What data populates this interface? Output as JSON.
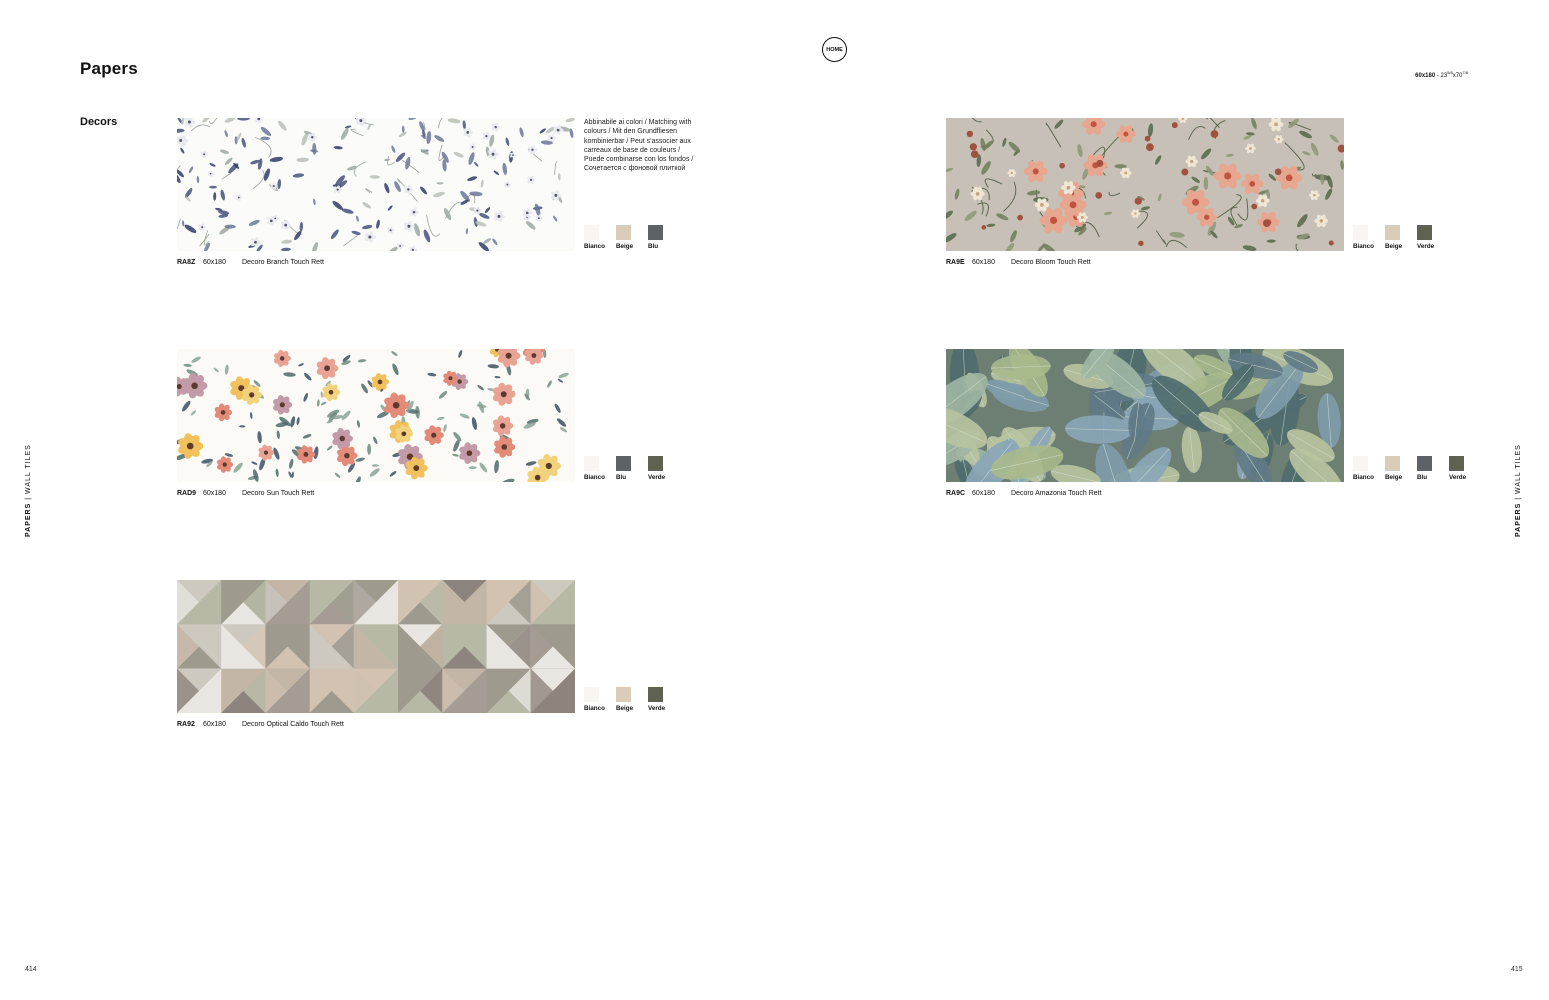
{
  "page": {
    "title": "Papers",
    "section": "Decors",
    "home_label": "HOME",
    "format_code": "60x180",
    "format_imperial": " - 23",
    "format_imperial_in1": "5/8",
    "format_imperial_x": "x70",
    "format_imperial_in2": "7/8",
    "side_label_strong": "PAPERS",
    "side_label_rest": " | WALL TILES",
    "page_left": "414",
    "page_right": "415",
    "matching_note": "Abbinabile ai colori / Matching with colours / Mit den Grundfliesen kombinierbar / Peut s'associer aux carreaux de base de couleurs / Puede combinarse con los fondos / Сочетается с фоновой плиткой"
  },
  "colors": {
    "Bianco": "#f7f6f3",
    "Beige": "#d9cdb9",
    "Blu": "#5b6368",
    "Verde": "#5f6152"
  },
  "products": [
    {
      "code": "RA8Z",
      "size": "60x180",
      "name": "Decoro Branch Touch Rett",
      "pattern": "branch",
      "swatches": [
        "Bianco",
        "Beige",
        "Blu"
      ]
    },
    {
      "code": "RA9E",
      "size": "60x180",
      "name": "Decoro Bloom Touch Rett",
      "pattern": "bloom",
      "swatches": [
        "Bianco",
        "Beige",
        "Verde"
      ]
    },
    {
      "code": "RAD9",
      "size": "60x180",
      "name": "Decoro Sun Touch Rett",
      "pattern": "sun",
      "swatches": [
        "Bianco",
        "Blu",
        "Verde"
      ]
    },
    {
      "code": "RA9C",
      "size": "60x180",
      "name": "Decoro Amazonia Touch Rett",
      "pattern": "amazonia",
      "swatches": [
        "Bianco",
        "Beige",
        "Blu",
        "Verde"
      ]
    },
    {
      "code": "RA92",
      "size": "60x180",
      "name": "Decoro Optical Caldo Touch Rett",
      "pattern": "optical",
      "swatches": [
        "Bianco",
        "Beige",
        "Verde"
      ]
    }
  ]
}
